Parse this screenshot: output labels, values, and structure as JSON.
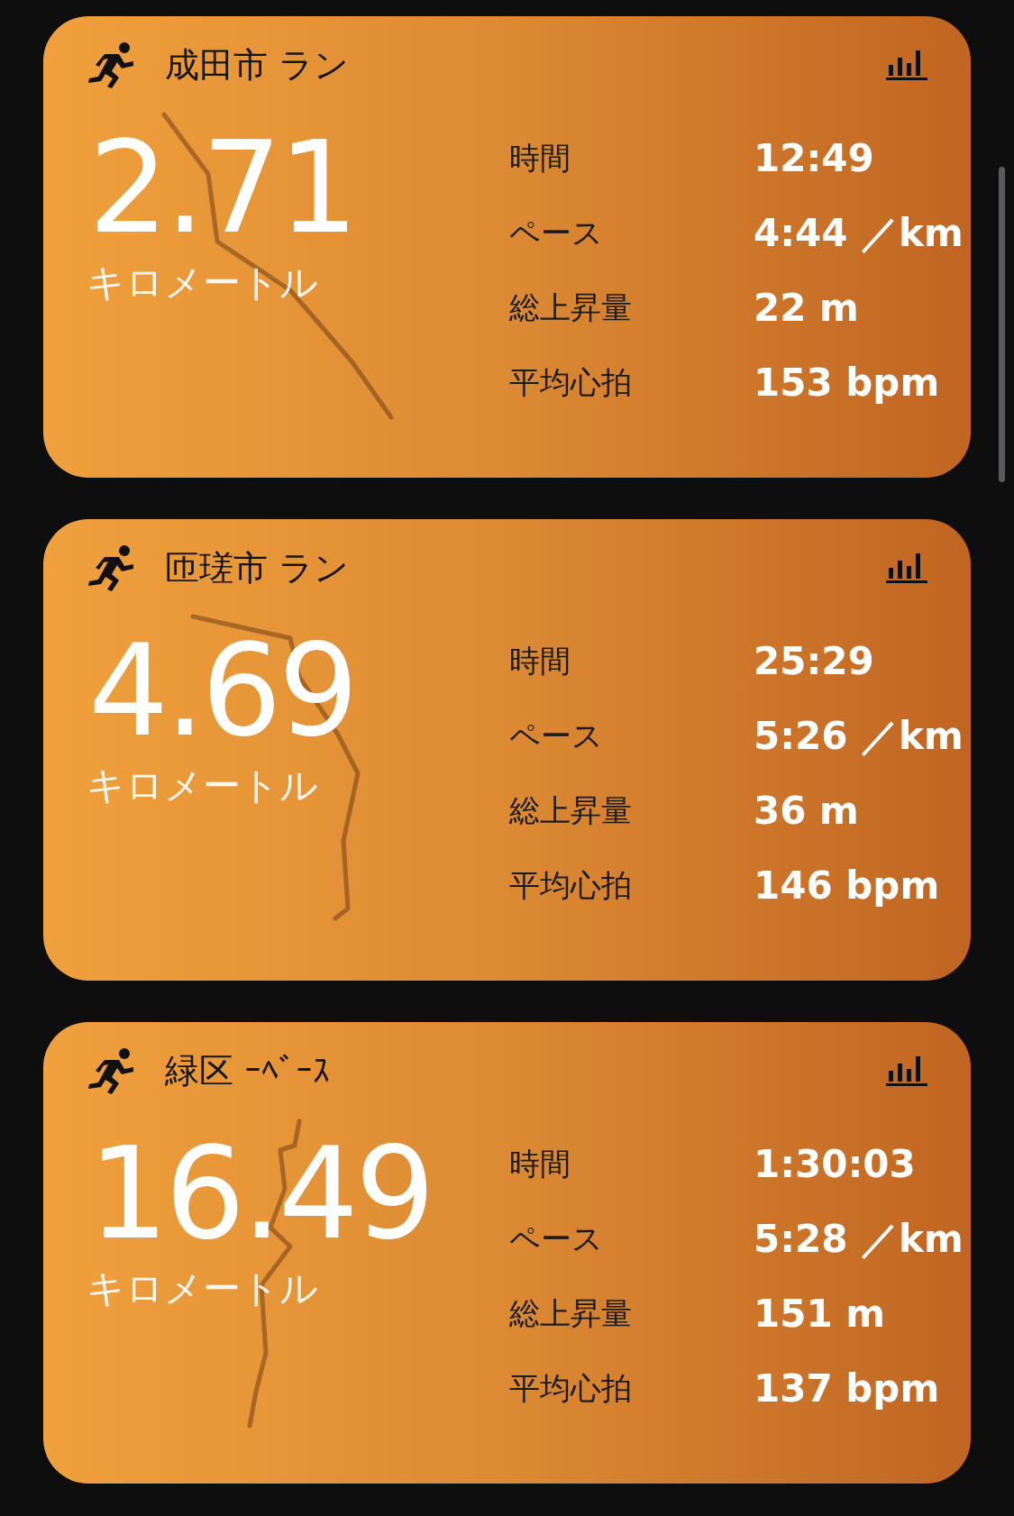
{
  "workouts": [
    {
      "title": "成田市 ラン",
      "distance": "2.71",
      "unit": "キロメートル",
      "stats": [
        {
          "label": "時間",
          "value": "12:49"
        },
        {
          "label": "ペース",
          "value": "4:44 ／km"
        },
        {
          "label": "総上昇量",
          "value": "22 m"
        },
        {
          "label": "平均心拍",
          "value": "153 bpm"
        }
      ]
    },
    {
      "title": "匝瑳市 ラン",
      "distance": "4.69",
      "unit": "キロメートル",
      "stats": [
        {
          "label": "時間",
          "value": "25:29"
        },
        {
          "label": "ペース",
          "value": "5:26 ／km"
        },
        {
          "label": "総上昇量",
          "value": "36 m"
        },
        {
          "label": "平均心拍",
          "value": "146 bpm"
        }
      ]
    },
    {
      "title": "緑区 ｰﾍﾞｰｽ",
      "distance": "16.49",
      "unit": "キロメートル",
      "stats": [
        {
          "label": "時間",
          "value": "1:30:03"
        },
        {
          "label": "ペース",
          "value": "5:28 ／km"
        },
        {
          "label": "総上昇量",
          "value": "151 m"
        },
        {
          "label": "平均心拍",
          "value": "137 bpm"
        }
      ]
    }
  ]
}
